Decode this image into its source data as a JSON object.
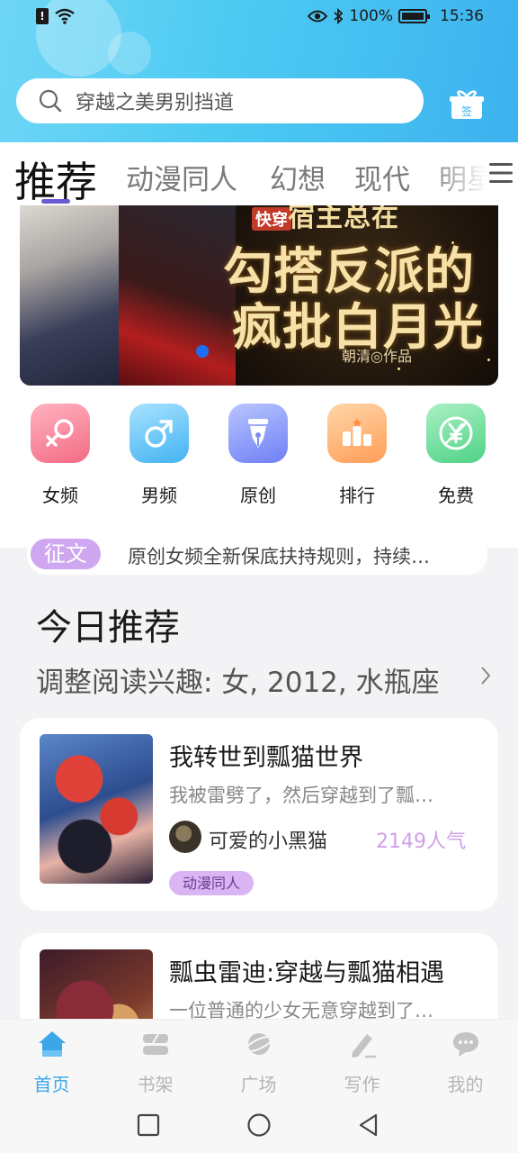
{
  "status_bar": {
    "battery": "100%",
    "time": "15:36",
    "icons": [
      "sim-alert-icon",
      "wifi-icon",
      "eye-icon",
      "bluetooth-icon",
      "battery-icon"
    ]
  },
  "header": {
    "search_placeholder": "穿越之美男别挡道",
    "checkin_label": "签"
  },
  "tabs": [
    "推荐",
    "动漫同人",
    "幻想",
    "现代",
    "明星"
  ],
  "active_tab": 0,
  "banner": {
    "tag": "快穿",
    "title_line1": "宿主总在",
    "title_line2": "勾搭反派的",
    "title_line3": "疯批白月光",
    "author": "朝清◎作品"
  },
  "categories": [
    {
      "label": "女频",
      "icon": "female-icon"
    },
    {
      "label": "男频",
      "icon": "male-icon"
    },
    {
      "label": "原创",
      "icon": "fountain-pen-icon"
    },
    {
      "label": "排行",
      "icon": "podium-icon"
    },
    {
      "label": "免费",
      "icon": "yen-icon"
    }
  ],
  "notice": {
    "badge": "征文",
    "text": "原创女频全新保底扶持规则，持续…"
  },
  "today": {
    "title": "今日推荐",
    "interest": "调整阅读兴趣: 女, 2012, 水瓶座"
  },
  "books": [
    {
      "title": "我转世到瓢猫世界",
      "desc": "我被雷劈了，然后穿越到了瓢…",
      "author": "可爱的小黑猫",
      "popularity": "2149人气",
      "genre": "动漫同人"
    },
    {
      "title": "瓢虫雷迪:穿越与瓢猫相遇",
      "desc": "一位普通的少女无意穿越到了…"
    }
  ],
  "bottom_nav": [
    {
      "label": "首页",
      "icon": "home-icon"
    },
    {
      "label": "书架",
      "icon": "bookshelf-icon"
    },
    {
      "label": "广场",
      "icon": "planet-icon"
    },
    {
      "label": "写作",
      "icon": "pen-icon"
    },
    {
      "label": "我的",
      "icon": "chat-icon"
    }
  ],
  "colors": {
    "header_gradient_start": "#6fd6f6",
    "header_gradient_end": "#3db2ef",
    "accent_purple": "#6a5ad4",
    "nav_active": "#3ba7e8",
    "popularity": "#cfa1e8"
  }
}
